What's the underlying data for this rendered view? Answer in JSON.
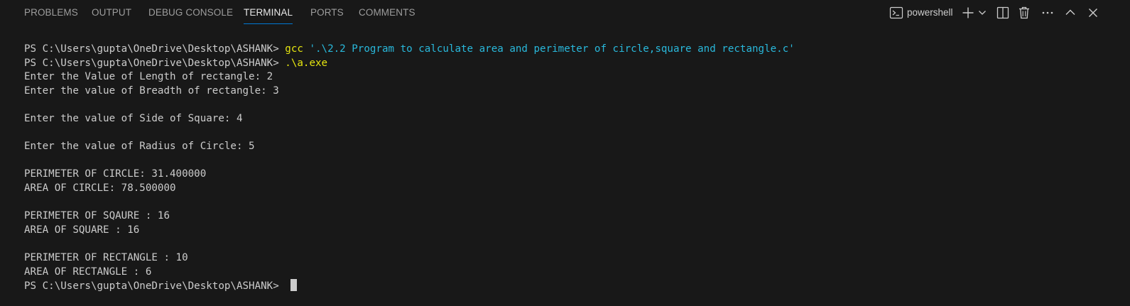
{
  "tabs": [
    {
      "label": "PROBLEMS",
      "active": false
    },
    {
      "label": "OUTPUT",
      "active": false
    },
    {
      "label": "DEBUG CONSOLE",
      "active": false
    },
    {
      "label": "TERMINAL",
      "active": true
    },
    {
      "label": "PORTS",
      "active": false
    },
    {
      "label": "COMMENTS",
      "active": false
    }
  ],
  "toolbar": {
    "shell_name": "powershell",
    "icons": [
      "terminal-icon",
      "add-icon",
      "chevron-down-icon",
      "split-icon",
      "trash-icon",
      "more-icon",
      "chevron-up-icon",
      "close-icon"
    ]
  },
  "terminal": {
    "prompt": "PS C:\\Users\\gupta\\OneDrive\\Desktop\\ASHANK> ",
    "cmd1_name": "gcc",
    "cmd1_arg": " '.\\2.2 Program to calculate area and perimeter of circle,square and rectangle.c'",
    "cmd2": ".\\a.exe",
    "output": [
      "Enter the Value of Length of rectangle: 2",
      "Enter the value of Breadth of rectangle: 3",
      "",
      "Enter the value of Side of Square: 4",
      "",
      "Enter the value of Radius of Circle: 5",
      "",
      "PERIMETER OF CIRCLE: 31.400000",
      "AREA OF CIRCLE: 78.500000",
      "",
      "PERIMETER OF SQAURE : 16",
      "AREA OF SQUARE : 16",
      "",
      "PERIMETER OF RECTANGLE : 10",
      "AREA OF RECTANGLE : 6"
    ]
  },
  "colors": {
    "background": "#181818",
    "text": "#cccccc",
    "command": "#e5e510",
    "argument": "#29b8db",
    "active_tab_underline": "#0078d4"
  }
}
